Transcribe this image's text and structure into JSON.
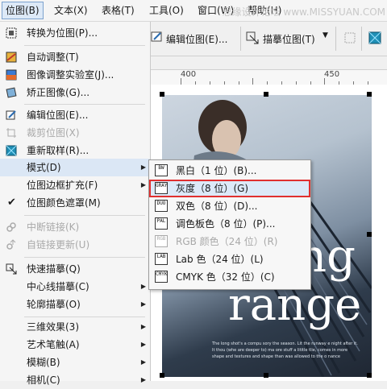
{
  "menubar": {
    "items": [
      {
        "label": "位图(B)"
      },
      {
        "label": "文本(X)"
      },
      {
        "label": "表格(T)"
      },
      {
        "label": "工具(O)"
      },
      {
        "label": "窗口(W)"
      },
      {
        "label": "帮助(H)"
      }
    ],
    "watermark": "思缘设计论坛 www.MISSYUAN.COM"
  },
  "toolbar": {
    "edit_bitmap": "编辑位图(E)...",
    "trace_bitmap": "描摹位图(T)"
  },
  "ruler": {
    "labels": [
      "400",
      "450"
    ]
  },
  "menu": {
    "items": [
      {
        "label": "转换为位图(P)...",
        "icon": "convert-bitmap-icon"
      },
      {
        "label": "自动调整(T)",
        "icon": "auto-adjust-icon"
      },
      {
        "label": "图像调整实验室(J)...",
        "icon": "image-lab-icon"
      },
      {
        "label": "矫正图像(G)...",
        "icon": "straighten-icon"
      },
      {
        "label": "编辑位图(E)...",
        "icon": "edit-bitmap-icon"
      },
      {
        "label": "裁剪位图(X)",
        "icon": "crop-bitmap-icon"
      },
      {
        "label": "重新取样(R)...",
        "icon": "resample-icon"
      },
      {
        "label": "模式(D)"
      },
      {
        "label": "位图边框扩充(F)"
      },
      {
        "label": "位图颜色遮罩(M)",
        "icon": "checkmark-icon"
      },
      {
        "label": "中断链接(K)",
        "icon": "break-link-icon"
      },
      {
        "label": "自链接更新(U)",
        "icon": "update-link-icon"
      },
      {
        "label": "快速描摹(Q)",
        "icon": "quick-trace-icon"
      },
      {
        "label": "中心线描摹(C)"
      },
      {
        "label": "轮廓描摹(O)"
      },
      {
        "label": "三维效果(3)"
      },
      {
        "label": "艺术笔触(A)"
      },
      {
        "label": "模糊(B)"
      },
      {
        "label": "相机(C)"
      }
    ]
  },
  "submenu": {
    "items": [
      {
        "label": "黑白（1 位）(B)...",
        "badge": "BW"
      },
      {
        "label": "灰度（8 位）(G)",
        "badge": "GRAY"
      },
      {
        "label": "双色（8 位）(D)...",
        "badge": "DUO"
      },
      {
        "label": "调色板色（8 位）(P)...",
        "badge": "PAL"
      },
      {
        "label": "RGB 颜色（24 位）(R)",
        "badge": "RGB"
      },
      {
        "label": "Lab 色（24 位）(L)",
        "badge": "LAB"
      },
      {
        "label": "CMYK 色（32 位）(C)",
        "badge": "CMYK"
      }
    ]
  },
  "photo": {
    "headline_1": "ng",
    "headline_2": "range",
    "caption_1": "The long shot's a compu sory the season. Lit the runway e night after it.",
    "caption_2": "It thou (whe are deeper to)  ma  ore stuff a lititle  tlie, comes in more",
    "caption_3": "shape and textures and shape than was allowed  to the  o  nance"
  },
  "colors": {
    "accent": "#7da2ce",
    "highlight": "#e03030"
  }
}
